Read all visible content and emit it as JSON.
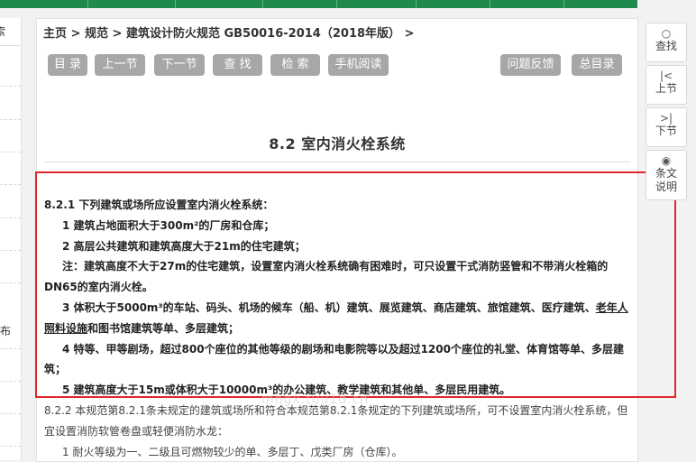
{
  "breadcrumb": {
    "home": "主页",
    "sep1": " > ",
    "spec": "规范",
    "sep2": " > ",
    "doc": "建筑设计防火规范 GB50016-2014（2018年版）",
    "sep3": " >"
  },
  "toolbar": {
    "toc": "目 录",
    "prev": "上一节",
    "next": "下一节",
    "find": "查 找",
    "search": "检 索",
    "mobile": "手机阅读",
    "feedback": "问题反馈",
    "master_toc": "总目录"
  },
  "left_panel": {
    "tab_fragment": "索",
    "text_fragment": "面布"
  },
  "section_title": "8.2  室内消火栓系统",
  "clauses": {
    "c821_head": "8.2.1 下列建筑或场所应设置室内消火栓系统：",
    "c821_1": "1 建筑占地面积大于300m²的厂房和仓库；",
    "c821_2": "2 高层公共建筑和建筑高度大于21m的住宅建筑；",
    "c821_note": "注：建筑高度不大于27m的住宅建筑，设置室内消火栓系统确有困难时，可只设置干式消防竖管和不带消火栓箱的DN65的室内消火栓。",
    "c821_3a": "3 体积大于5000m³的车站、码头、机场的候车（船、机）建筑、展览建筑、商店建筑、旅馆建筑、医疗建筑、",
    "c821_3b": "老年人照料设施",
    "c821_3c": "和图书馆建筑等单、多层建筑；",
    "c821_4": "4 特等、甲等剧场，超过800个座位的其他等级的剧场和电影院等以及超过1200个座位的礼堂、体育馆等单、多层建筑；",
    "c821_5": "5 建筑高度大于15m或体积大于10000m³的办公建筑、教学建筑和其他单、多层民用建筑。",
    "c822_head": "8.2.2 本规范第8.2.1条未规定的建筑或场所和符合本规范第8.2.1条规定的下列建筑或场所，可不设置室内消火栓系统，但宜设置消防软管卷盘或轻便消防水龙：",
    "c822_1": "1 耐火等级为一、二级且可燃物较少的单、多层丁、戊类厂房（仓库）。"
  },
  "watermark": "mhgx.tuu1d.cn",
  "side_tools": {
    "find": {
      "label": "查找",
      "icon": "search-icon"
    },
    "prev": {
      "label": "上节",
      "icon": "prev-icon"
    },
    "next": {
      "label": "下节",
      "icon": "next-icon"
    },
    "explain": {
      "label": "条文说明",
      "icon": "eye-icon"
    }
  },
  "colors": {
    "top_bar": "#1f8a4c",
    "button_gray": "#a7a7a7",
    "highlight_red": "#e0282b"
  }
}
